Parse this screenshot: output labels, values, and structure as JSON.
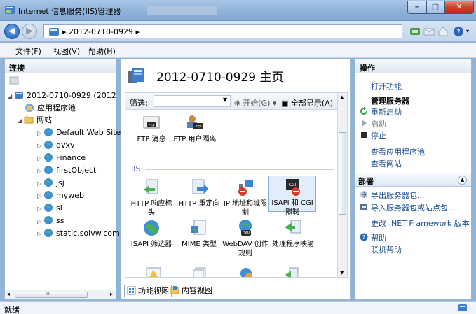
{
  "window": {
    "title": "Internet 信息服务(IIS)管理器"
  },
  "address": {
    "path": "2012-0710-0929",
    "separator_1": "▸",
    "separator_2": "▸"
  },
  "menu": {
    "file": "文件(F)",
    "view": "视图(V)",
    "help": "帮助(H)"
  },
  "connections": {
    "header": "连接",
    "tree": [
      {
        "label": "2012-0710-0929 (2012",
        "icon": "server-icon"
      },
      {
        "label": "应用程序池",
        "icon": "app-pool-icon"
      },
      {
        "label": "网站",
        "icon": "sites-folder-icon"
      },
      {
        "label": "Default Web Site",
        "icon": "globe-icon"
      },
      {
        "label": "dvxv",
        "icon": "globe-icon"
      },
      {
        "label": "Finance",
        "icon": "globe-icon"
      },
      {
        "label": "firstObject",
        "icon": "globe-icon"
      },
      {
        "label": "jsj",
        "icon": "globe-icon"
      },
      {
        "label": "myweb",
        "icon": "globe-icon"
      },
      {
        "label": "sl",
        "icon": "globe-icon"
      },
      {
        "label": "ss",
        "icon": "globe-icon"
      },
      {
        "label": "static.solvw.com",
        "icon": "globe-icon"
      }
    ],
    "scroll_glyph": "III"
  },
  "center": {
    "title": "2012-0710-0929 主页",
    "filter_label": "筛选:",
    "start_label": "开始(G)",
    "show_all_label": "全部显示(A)",
    "group_iis": "IIS",
    "features": [
      {
        "label": "FTP 消息",
        "icon": "ftp-messages-icon"
      },
      {
        "label": "FTP 用户隔离",
        "icon": "ftp-user-isolation-icon"
      },
      {
        "label": "HTTP 响应标头",
        "icon": "http-response-headers-icon"
      },
      {
        "label": "HTTP 重定向",
        "icon": "http-redirect-icon"
      },
      {
        "label": "IP 地址和域限制",
        "icon": "ip-domain-restrictions-icon"
      },
      {
        "label": "ISAPI 和 CGI 限制",
        "icon": "isapi-cgi-restrictions-icon"
      },
      {
        "label": "ISAPI 筛选器",
        "icon": "isapi-filters-icon"
      },
      {
        "label": "MIME 类型",
        "icon": "mime-types-icon"
      },
      {
        "label": "WebDAV 创作规则",
        "icon": "webdav-authoring-icon"
      },
      {
        "label": "处理程序映射",
        "icon": "handler-mappings-icon"
      }
    ],
    "tabs": {
      "features_view": "功能视图",
      "content_view": "内容视图"
    }
  },
  "actions": {
    "header": "操作",
    "open_feature": "打开功能",
    "manage_server": "管理服务器",
    "restart": "重新启动",
    "start": "启动",
    "stop": "停止",
    "view_app_pools": "查看应用程序池",
    "view_sites": "查看网站",
    "deploy_header": "部署",
    "export_package": "导出服务器包...",
    "import_package": "导入服务器包或站点包...",
    "change_framework": "更改 .NET Framework 版本",
    "help": "帮助",
    "online_help": "联机帮助"
  },
  "status": {
    "text": "就绪"
  }
}
